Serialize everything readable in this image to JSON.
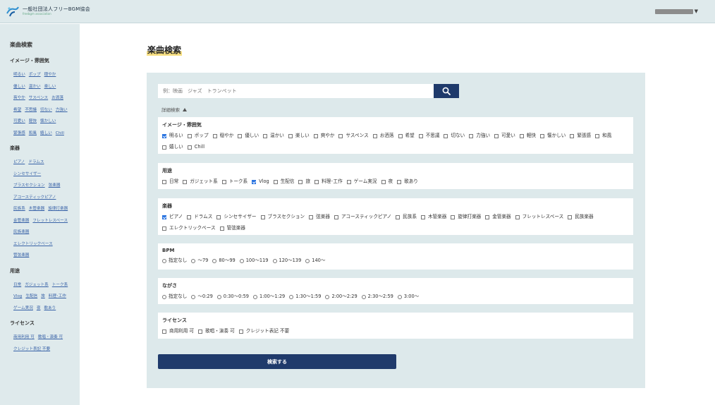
{
  "header": {
    "logo_title": "一般社団法人フリーBGM協会",
    "logo_subtitle": "freebgm association",
    "user_menu_icon": "caret-down-icon"
  },
  "sidebar": {
    "title": "楽曲検索",
    "groups": [
      {
        "title": "イメージ・雰囲気",
        "links": [
          "明るい",
          "ポップ",
          "穏やか",
          "優しい",
          "温かい",
          "楽しい",
          "爽やか",
          "サスペンス",
          "お洒落",
          "希望",
          "不思議",
          "切ない",
          "力強い",
          "可愛い",
          "軽快",
          "懐かしい",
          "緊張感",
          "和風",
          "嬉しい",
          "Chill"
        ]
      },
      {
        "title": "楽器",
        "links": [
          "ピアノ",
          "ドラムス",
          "シンセサイザー",
          "ブラスセクション",
          "弦楽器",
          "アコースティックピアノ",
          "民族系",
          "木管楽器",
          "旋律打楽器",
          "金管楽器",
          "フレットレスベース",
          "民族楽器",
          "エレクトリックベース",
          "管弦楽器"
        ]
      },
      {
        "title": "用途",
        "links": [
          "日常",
          "ガジェット系",
          "トーク系",
          "Vlog",
          "生配信",
          "旅",
          "料理･工作",
          "ゲーム実況",
          "夜",
          "歌あり"
        ]
      },
      {
        "title": "ライセンス",
        "links": [
          "商用利用 可",
          "歌唱・演奏 可",
          "クレジット表記 不要"
        ]
      }
    ]
  },
  "main": {
    "page_title": "楽曲検索",
    "search_placeholder": "例：映画　ジャズ　トランペット",
    "search_icon": "search-icon",
    "advanced_label": "詳細検索",
    "submit_label": "検索する",
    "sections": [
      {
        "title": "イメージ・雰囲気",
        "type": "checkbox",
        "options": [
          {
            "label": "明るい",
            "checked": true
          },
          {
            "label": "ポップ",
            "checked": false
          },
          {
            "label": "穏やか",
            "checked": false
          },
          {
            "label": "優しい",
            "checked": false
          },
          {
            "label": "温かい",
            "checked": false
          },
          {
            "label": "楽しい",
            "checked": false
          },
          {
            "label": "爽やか",
            "checked": false
          },
          {
            "label": "サスペンス",
            "checked": false
          },
          {
            "label": "お洒落",
            "checked": false
          },
          {
            "label": "希望",
            "checked": false
          },
          {
            "label": "不思議",
            "checked": false
          },
          {
            "label": "切ない",
            "checked": false
          },
          {
            "label": "力強い",
            "checked": false
          },
          {
            "label": "可愛い",
            "checked": false
          },
          {
            "label": "軽快",
            "checked": false
          },
          {
            "label": "懐かしい",
            "checked": false
          },
          {
            "label": "緊張感",
            "checked": false
          },
          {
            "label": "和風",
            "checked": false
          },
          {
            "label": "嬉しい",
            "checked": false
          },
          {
            "label": "Chill",
            "checked": false
          }
        ]
      },
      {
        "title": "用途",
        "type": "checkbox",
        "options": [
          {
            "label": "日常",
            "checked": false
          },
          {
            "label": "ガジェット系",
            "checked": false
          },
          {
            "label": "トーク系",
            "checked": false
          },
          {
            "label": "Vlog",
            "checked": true
          },
          {
            "label": "生配信",
            "checked": false
          },
          {
            "label": "旅",
            "checked": false
          },
          {
            "label": "料理･工作",
            "checked": false
          },
          {
            "label": "ゲーム実況",
            "checked": false
          },
          {
            "label": "夜",
            "checked": false
          },
          {
            "label": "歌あり",
            "checked": false
          }
        ]
      },
      {
        "title": "楽器",
        "type": "checkbox",
        "options": [
          {
            "label": "ピアノ",
            "checked": true
          },
          {
            "label": "ドラムス",
            "checked": false
          },
          {
            "label": "シンセサイザー",
            "checked": false
          },
          {
            "label": "ブラスセクション",
            "checked": false
          },
          {
            "label": "弦楽器",
            "checked": false
          },
          {
            "label": "アコースティックピアノ",
            "checked": false
          },
          {
            "label": "民族系",
            "checked": false
          },
          {
            "label": "木管楽器",
            "checked": false
          },
          {
            "label": "旋律打楽器",
            "checked": false
          },
          {
            "label": "金管楽器",
            "checked": false
          },
          {
            "label": "フレットレスベース",
            "checked": false
          },
          {
            "label": "民族楽器",
            "checked": false
          },
          {
            "label": "エレクトリックベース",
            "checked": false
          },
          {
            "label": "管弦楽器",
            "checked": false
          }
        ]
      },
      {
        "title": "BPM",
        "type": "radio",
        "options": [
          {
            "label": "指定なし"
          },
          {
            "label": "〜79"
          },
          {
            "label": "80〜99"
          },
          {
            "label": "100〜119"
          },
          {
            "label": "120〜139"
          },
          {
            "label": "140〜"
          }
        ]
      },
      {
        "title": "ながさ",
        "type": "radio",
        "options": [
          {
            "label": "指定なし"
          },
          {
            "label": "〜0:29"
          },
          {
            "label": "0:30〜0:59"
          },
          {
            "label": "1:00〜1:29"
          },
          {
            "label": "1:30〜1:59"
          },
          {
            "label": "2:00〜2:29"
          },
          {
            "label": "2:30〜2:59"
          },
          {
            "label": "3:00〜"
          }
        ]
      },
      {
        "title": "ライセンス",
        "type": "checkbox",
        "options": [
          {
            "label": "商用利用 可",
            "checked": false
          },
          {
            "label": "歌唱・演奏 可",
            "checked": false
          },
          {
            "label": "クレジット表記 不要",
            "checked": false
          }
        ]
      }
    ]
  }
}
